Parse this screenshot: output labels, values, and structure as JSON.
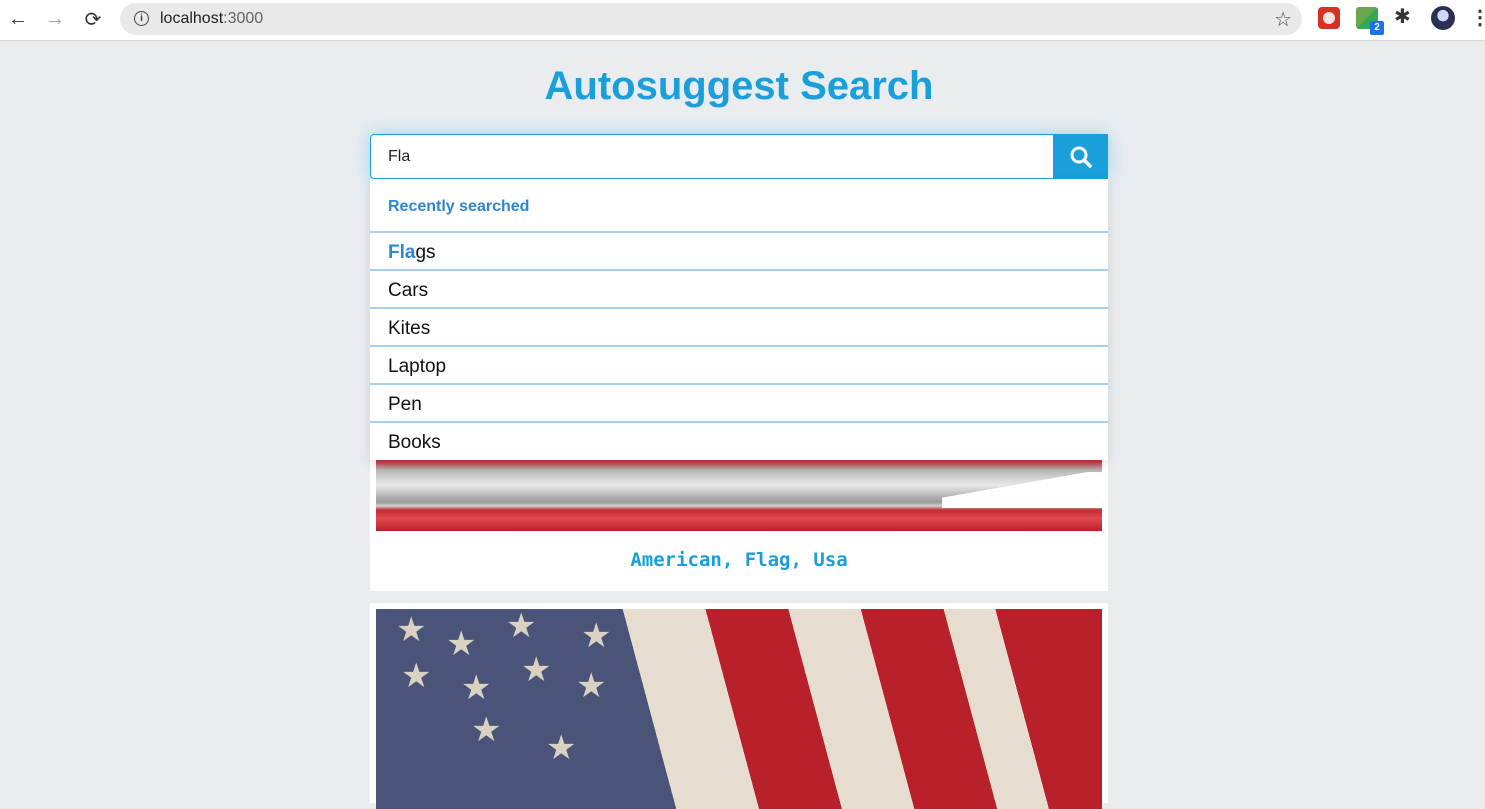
{
  "browser": {
    "url_host": "localhost",
    "url_port": ":3000",
    "extension_badge": "2"
  },
  "page": {
    "title": "Autosuggest Search"
  },
  "search": {
    "value": "Fla",
    "placeholder": ""
  },
  "dropdown": {
    "header": "Recently searched",
    "items": [
      {
        "match": "Fla",
        "rest": "gs"
      },
      {
        "match": "",
        "rest": "Cars"
      },
      {
        "match": "",
        "rest": "Kites"
      },
      {
        "match": "",
        "rest": "Laptop"
      },
      {
        "match": "",
        "rest": "Pen"
      },
      {
        "match": "",
        "rest": "Books"
      }
    ]
  },
  "results": [
    {
      "caption": "American, Flag, Usa"
    },
    {
      "caption": ""
    }
  ],
  "colors": {
    "accent": "#1a9fdb",
    "highlight": "#2f86cf",
    "background": "#e9edf0"
  }
}
